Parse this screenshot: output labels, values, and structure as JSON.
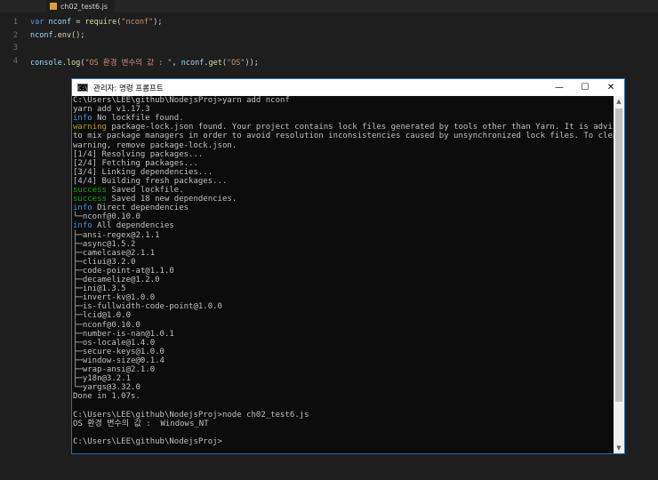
{
  "editor": {
    "tab_label": "ch02_test6.js",
    "line_numbers": [
      "1",
      "2",
      "3",
      "4"
    ],
    "lines": [
      [
        {
          "t": "var ",
          "c": "kw"
        },
        {
          "t": "nconf",
          "c": "var"
        },
        {
          "t": " = ",
          "c": ""
        },
        {
          "t": "require",
          "c": "fn"
        },
        {
          "t": "(",
          "c": ""
        },
        {
          "t": "\"nconf\"",
          "c": "str"
        },
        {
          "t": ");",
          "c": ""
        }
      ],
      [
        {
          "t": "nconf",
          "c": "var"
        },
        {
          "t": ".",
          "c": ""
        },
        {
          "t": "env",
          "c": "fn"
        },
        {
          "t": "();",
          "c": ""
        }
      ],
      [],
      [
        {
          "t": "console",
          "c": "var"
        },
        {
          "t": ".",
          "c": ""
        },
        {
          "t": "log",
          "c": "fn"
        },
        {
          "t": "(",
          "c": ""
        },
        {
          "t": "\"OS 환경 변수의 값 : \"",
          "c": "str"
        },
        {
          "t": ", ",
          "c": ""
        },
        {
          "t": "nconf",
          "c": "var"
        },
        {
          "t": ".",
          "c": ""
        },
        {
          "t": "get",
          "c": "fn"
        },
        {
          "t": "(",
          "c": ""
        },
        {
          "t": "\"OS\"",
          "c": "str"
        },
        {
          "t": "));",
          "c": ""
        }
      ]
    ]
  },
  "terminal": {
    "title": "관리자: 명령 프롬프트",
    "title_icon_text": "C:\\",
    "minimize": "—",
    "maximize": "☐",
    "close": "✕",
    "lines": [
      [
        {
          "t": "C:\\Users\\LEE\\github\\NodejsProj>yarn add nconf",
          "c": ""
        }
      ],
      [
        {
          "t": "yarn add v1.17.3",
          "c": ""
        }
      ],
      [
        {
          "t": "info",
          "c": "info"
        },
        {
          "t": " No lockfile found.",
          "c": ""
        }
      ],
      [
        {
          "t": "warning",
          "c": "warn"
        },
        {
          "t": " package-lock.json found. Your project contains lock files generated by tools other than Yarn. It is advised not",
          "c": ""
        }
      ],
      [
        {
          "t": "to mix package managers in order to avoid resolution inconsistencies caused by unsynchronized lock files. To clear this",
          "c": ""
        }
      ],
      [
        {
          "t": "warning, remove package-lock.json.",
          "c": ""
        }
      ],
      [
        {
          "t": "[1/4] Resolving packages...",
          "c": ""
        }
      ],
      [
        {
          "t": "[2/4] Fetching packages...",
          "c": ""
        }
      ],
      [
        {
          "t": "[3/4] Linking dependencies...",
          "c": ""
        }
      ],
      [
        {
          "t": "[4/4] Building fresh packages...",
          "c": ""
        }
      ],
      [
        {
          "t": "success",
          "c": "succ"
        },
        {
          "t": " Saved lockfile.",
          "c": ""
        }
      ],
      [
        {
          "t": "success",
          "c": "succ"
        },
        {
          "t": " Saved 18 new dependencies.",
          "c": ""
        }
      ],
      [
        {
          "t": "info",
          "c": "info"
        },
        {
          "t": " Direct dependencies",
          "c": ""
        }
      ],
      [
        {
          "t": "└─nconf@0.10.0",
          "c": ""
        }
      ],
      [
        {
          "t": "info",
          "c": "info"
        },
        {
          "t": " All dependencies",
          "c": ""
        }
      ],
      [
        {
          "t": "├─ansi-regex@2.1.1",
          "c": ""
        }
      ],
      [
        {
          "t": "├─async@1.5.2",
          "c": ""
        }
      ],
      [
        {
          "t": "├─camelcase@2.1.1",
          "c": ""
        }
      ],
      [
        {
          "t": "├─cliui@3.2.0",
          "c": ""
        }
      ],
      [
        {
          "t": "├─code-point-at@1.1.0",
          "c": ""
        }
      ],
      [
        {
          "t": "├─decamelize@1.2.0",
          "c": ""
        }
      ],
      [
        {
          "t": "├─ini@1.3.5",
          "c": ""
        }
      ],
      [
        {
          "t": "├─invert-kv@1.0.0",
          "c": ""
        }
      ],
      [
        {
          "t": "├─is-fullwidth-code-point@1.0.0",
          "c": ""
        }
      ],
      [
        {
          "t": "├─lcid@1.0.0",
          "c": ""
        }
      ],
      [
        {
          "t": "├─nconf@0.10.0",
          "c": ""
        }
      ],
      [
        {
          "t": "├─number-is-nan@1.0.1",
          "c": ""
        }
      ],
      [
        {
          "t": "├─os-locale@1.4.0",
          "c": ""
        }
      ],
      [
        {
          "t": "├─secure-keys@1.0.0",
          "c": ""
        }
      ],
      [
        {
          "t": "├─window-size@0.1.4",
          "c": ""
        }
      ],
      [
        {
          "t": "├─wrap-ansi@2.1.0",
          "c": ""
        }
      ],
      [
        {
          "t": "├─y18n@3.2.1",
          "c": ""
        }
      ],
      [
        {
          "t": "└─yargs@3.32.0",
          "c": ""
        }
      ],
      [
        {
          "t": "Done in 1.07s.",
          "c": ""
        }
      ],
      [],
      [
        {
          "t": "C:\\Users\\LEE\\github\\NodejsProj>node ch02_test6.js",
          "c": ""
        }
      ],
      [
        {
          "t": "OS 환경 변수의 값 :  Windows_NT",
          "c": ""
        }
      ],
      [],
      [
        {
          "t": "C:\\Users\\LEE\\github\\NodejsProj>",
          "c": ""
        }
      ]
    ]
  }
}
